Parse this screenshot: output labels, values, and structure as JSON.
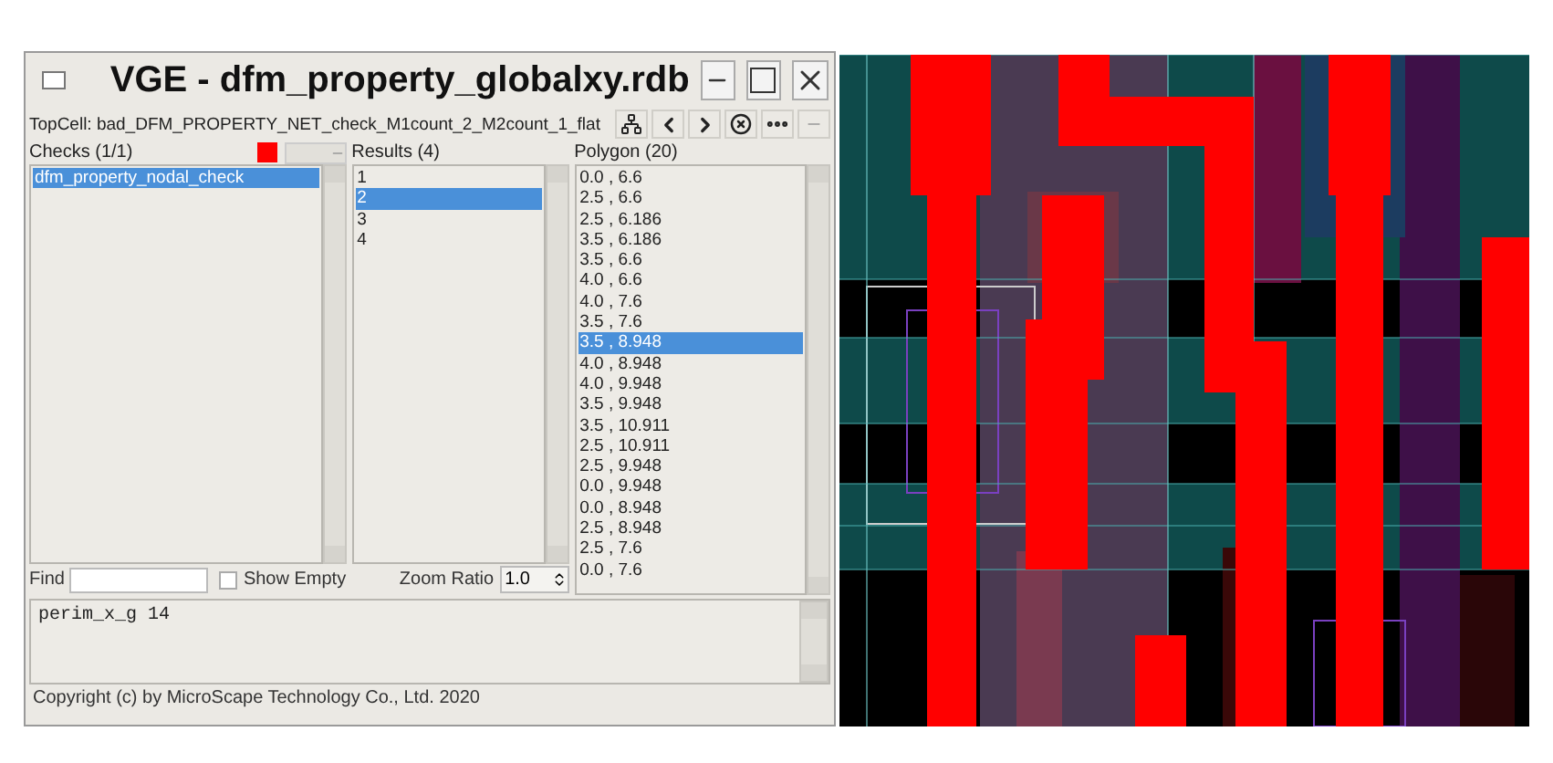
{
  "window": {
    "title": "VGE - dfm_property_globalxy.rdb"
  },
  "toolbar": {
    "topcell": "TopCell: bad_DFM_PROPERTY_NET_check_M1count_2_M2count_1_flat"
  },
  "checks": {
    "header": "Checks (1/1)",
    "color": "#ff0000",
    "items": [
      {
        "label": "dfm_property_nodal_check",
        "selected": true
      }
    ]
  },
  "results": {
    "header": "Results (4)",
    "items": [
      {
        "label": "1",
        "selected": false
      },
      {
        "label": "2",
        "selected": true
      },
      {
        "label": "3",
        "selected": false
      },
      {
        "label": "4",
        "selected": false
      }
    ]
  },
  "polygon": {
    "header": "Polygon (20)",
    "items": [
      {
        "label": "0.0 , 6.6",
        "selected": false
      },
      {
        "label": "2.5 , 6.6",
        "selected": false
      },
      {
        "label": "2.5 , 6.186",
        "selected": false
      },
      {
        "label": "3.5 , 6.186",
        "selected": false
      },
      {
        "label": "3.5 , 6.6",
        "selected": false
      },
      {
        "label": "4.0 , 6.6",
        "selected": false
      },
      {
        "label": "4.0 , 7.6",
        "selected": false
      },
      {
        "label": "3.5 , 7.6",
        "selected": false
      },
      {
        "label": "3.5 , 8.948",
        "selected": true
      },
      {
        "label": "4.0 , 8.948",
        "selected": false
      },
      {
        "label": "4.0 , 9.948",
        "selected": false
      },
      {
        "label": "3.5 , 9.948",
        "selected": false
      },
      {
        "label": "3.5 , 10.911",
        "selected": false
      },
      {
        "label": "2.5 , 10.911",
        "selected": false
      },
      {
        "label": "2.5 , 9.948",
        "selected": false
      },
      {
        "label": "0.0 , 9.948",
        "selected": false
      },
      {
        "label": "0.0 , 8.948",
        "selected": false
      },
      {
        "label": "2.5 , 8.948",
        "selected": false
      },
      {
        "label": "2.5 , 7.6",
        "selected": false
      },
      {
        "label": "0.0 , 7.6",
        "selected": false
      }
    ]
  },
  "find": {
    "label": "Find"
  },
  "show_empty": {
    "label": "Show Empty",
    "checked": false
  },
  "zoom_ratio": {
    "label": "Zoom Ratio",
    "value": "1.0"
  },
  "details": {
    "text": "perim_x_g 14"
  },
  "status_bar": "Copyright (c) by MicroScape Technology Co., Ltd. 2020"
}
